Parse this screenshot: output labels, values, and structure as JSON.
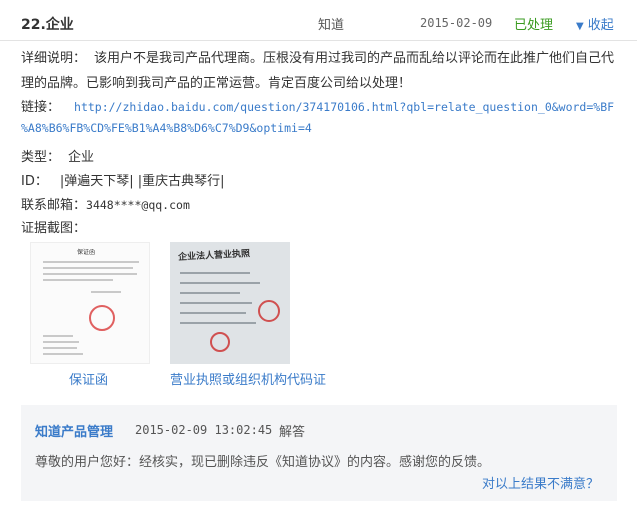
{
  "header": {
    "number": "22.企业",
    "category": "知道",
    "date": "2015-02-09",
    "status": "已处理",
    "status_color": "#3a9b20",
    "collapse_label": "收起",
    "collapse_icon": "triangle-down-icon"
  },
  "detail": {
    "description_label": "详细说明：",
    "description_text": "该用户不是我司产品代理商。压根没有用过我司的产品而乱给以评论而在此推广他们自己代理的品牌。已影响到我司产品的正常运营。肯定百度公司给以处理！",
    "link_label": "链接：",
    "link_line1": "http://zhidao.baidu.com/question/374170106.html?qbl=relate_question_0&word=%BF",
    "link_line2": "%A8%B6%FB%CD%FE%B1%A4%B8%D6%C7%D9&optimi=4",
    "type_label": "类型：",
    "type_value": "企业",
    "id_label": "ID：",
    "id_value": "|弹遍天下琴| |重庆古典琴行|",
    "email_label": "联系邮箱：",
    "email_value": "3448****@qq.com",
    "evidence_label": "证据截图："
  },
  "evidence": [
    {
      "caption": "保证函",
      "doc_title": "保证函"
    },
    {
      "caption": "营业执照或组织机构代码证",
      "doc_title": "企业法人营业执照"
    }
  ],
  "reply": {
    "author": "知道产品管理",
    "time": "2015-02-09 13:02:45",
    "action": "解答",
    "text": "尊敬的用户您好：经核实，现已删除违反《知道协议》的内容。感谢您的反馈。",
    "unsatisfied_link": "对以上结果不满意？"
  },
  "colors": {
    "link": "#3a7bc9",
    "reply_bg": "#f4f5f7"
  }
}
